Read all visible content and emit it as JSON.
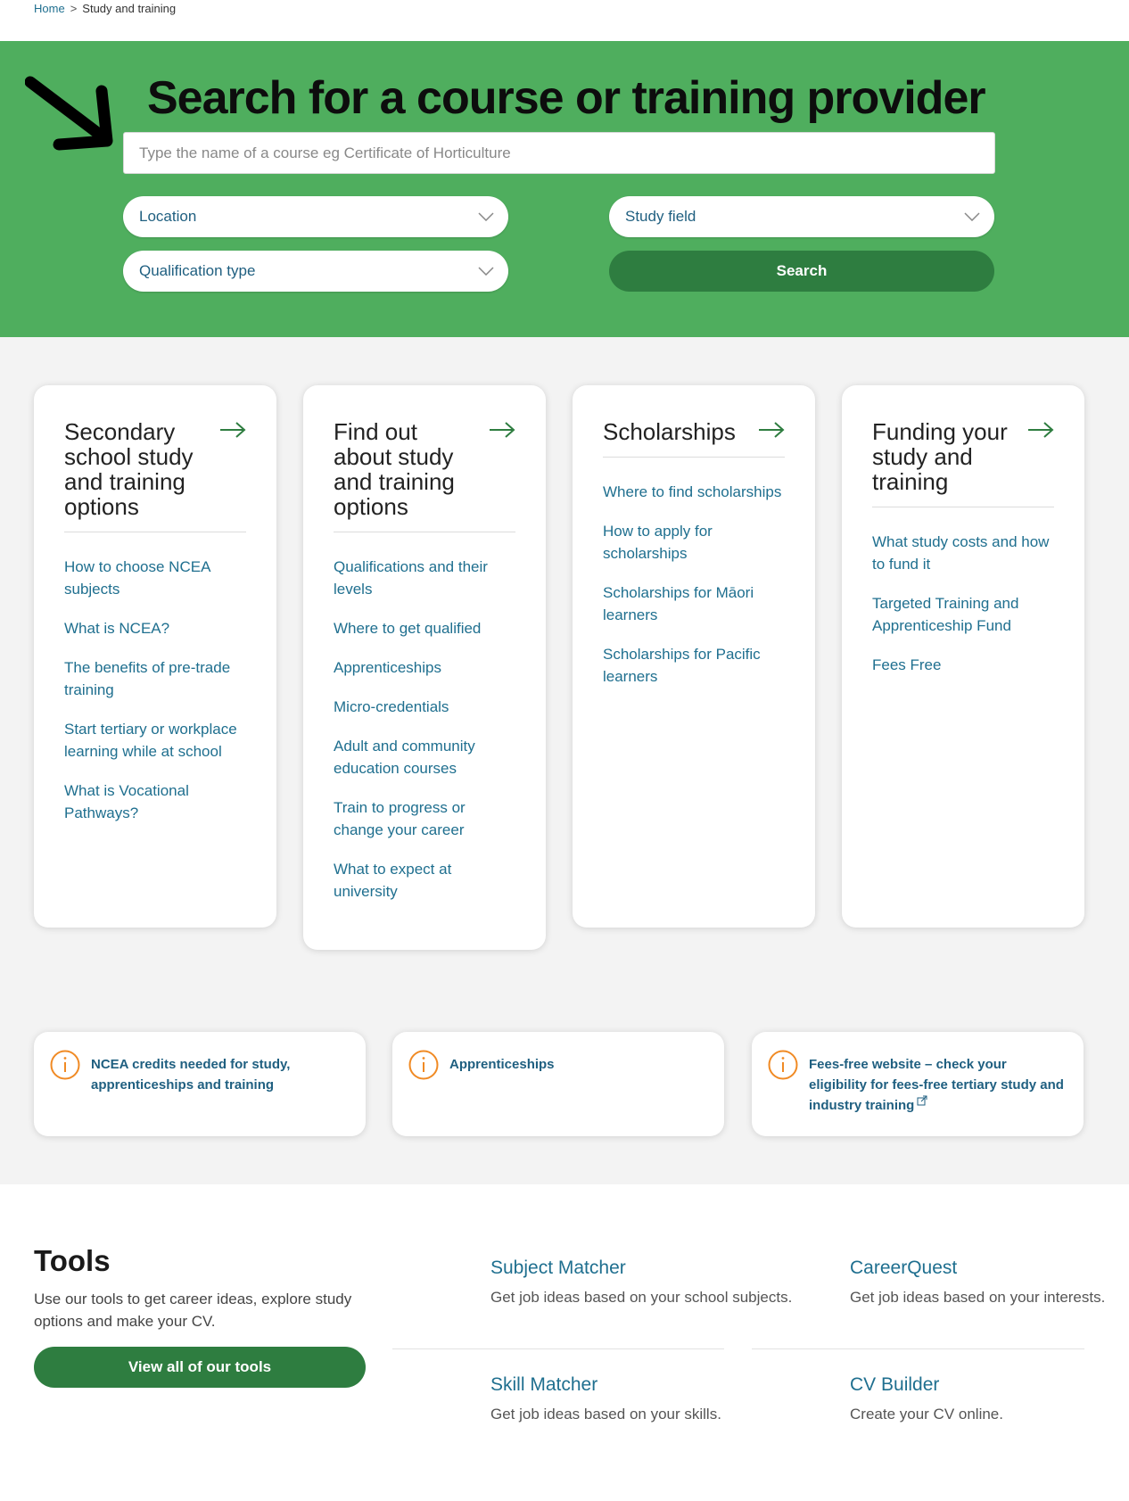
{
  "breadcrumb": {
    "home": "Home",
    "separator": ">",
    "current": "Study and training"
  },
  "hero": {
    "title": "Search for a course or training provider",
    "search_placeholder": "Type the name of a course eg Certificate of Horticulture",
    "location_label": "Location",
    "study_field_label": "Study field",
    "qualification_type_label": "Qualification type",
    "search_button": "Search",
    "colors": {
      "background": "#4fae5e",
      "button": "#2e7d40"
    }
  },
  "cards": [
    {
      "title": "Secondary school study and training options",
      "links": [
        "How to choose NCEA subjects",
        "What is NCEA?",
        "The benefits of pre-trade training",
        "Start tertiary or workplace learning while at school",
        "What is Vocational Pathways?"
      ]
    },
    {
      "title": "Find out about study and training options",
      "links": [
        "Qualifications and their levels",
        "Where to get qualified",
        "Apprenticeships",
        "Micro-credentials",
        "Adult and community education courses",
        "Train to progress or change your career",
        "What to expect at university"
      ]
    },
    {
      "title": "Scholarships",
      "links": [
        "Where to find scholarships",
        "How to apply for scholarships",
        "Scholarships for Māori learners",
        "Scholarships for Pacific learners"
      ]
    },
    {
      "title": "Funding your study and training",
      "links": [
        "What study costs and how to fund it",
        "Targeted Training and Apprenticeship Fund",
        "Fees Free"
      ]
    }
  ],
  "info_cards": [
    {
      "text": "NCEA credits needed for study, apprenticeships and training",
      "icon": "info-icon"
    },
    {
      "text": "Apprenticeships",
      "icon": "info-icon"
    },
    {
      "text": "Fees-free website – check your eligibility for fees-free tertiary study and industry training",
      "icon": "info-icon",
      "external": true
    }
  ],
  "tools": {
    "title": "Tools",
    "description": "Use our tools to get career ideas, explore study options and make your CV.",
    "button": "View all of our tools",
    "items": [
      {
        "name": "Subject Matcher",
        "description": "Get job ideas based on your school subjects."
      },
      {
        "name": "CareerQuest",
        "description": "Get job ideas based on your interests."
      },
      {
        "name": "Skill Matcher",
        "description": "Get job ideas based on your skills."
      },
      {
        "name": "CV Builder",
        "description": "Create your CV online."
      }
    ]
  },
  "colors": {
    "link": "#1f6f8f",
    "accent_orange": "#f08a24",
    "green_dark": "#2e7d40"
  }
}
